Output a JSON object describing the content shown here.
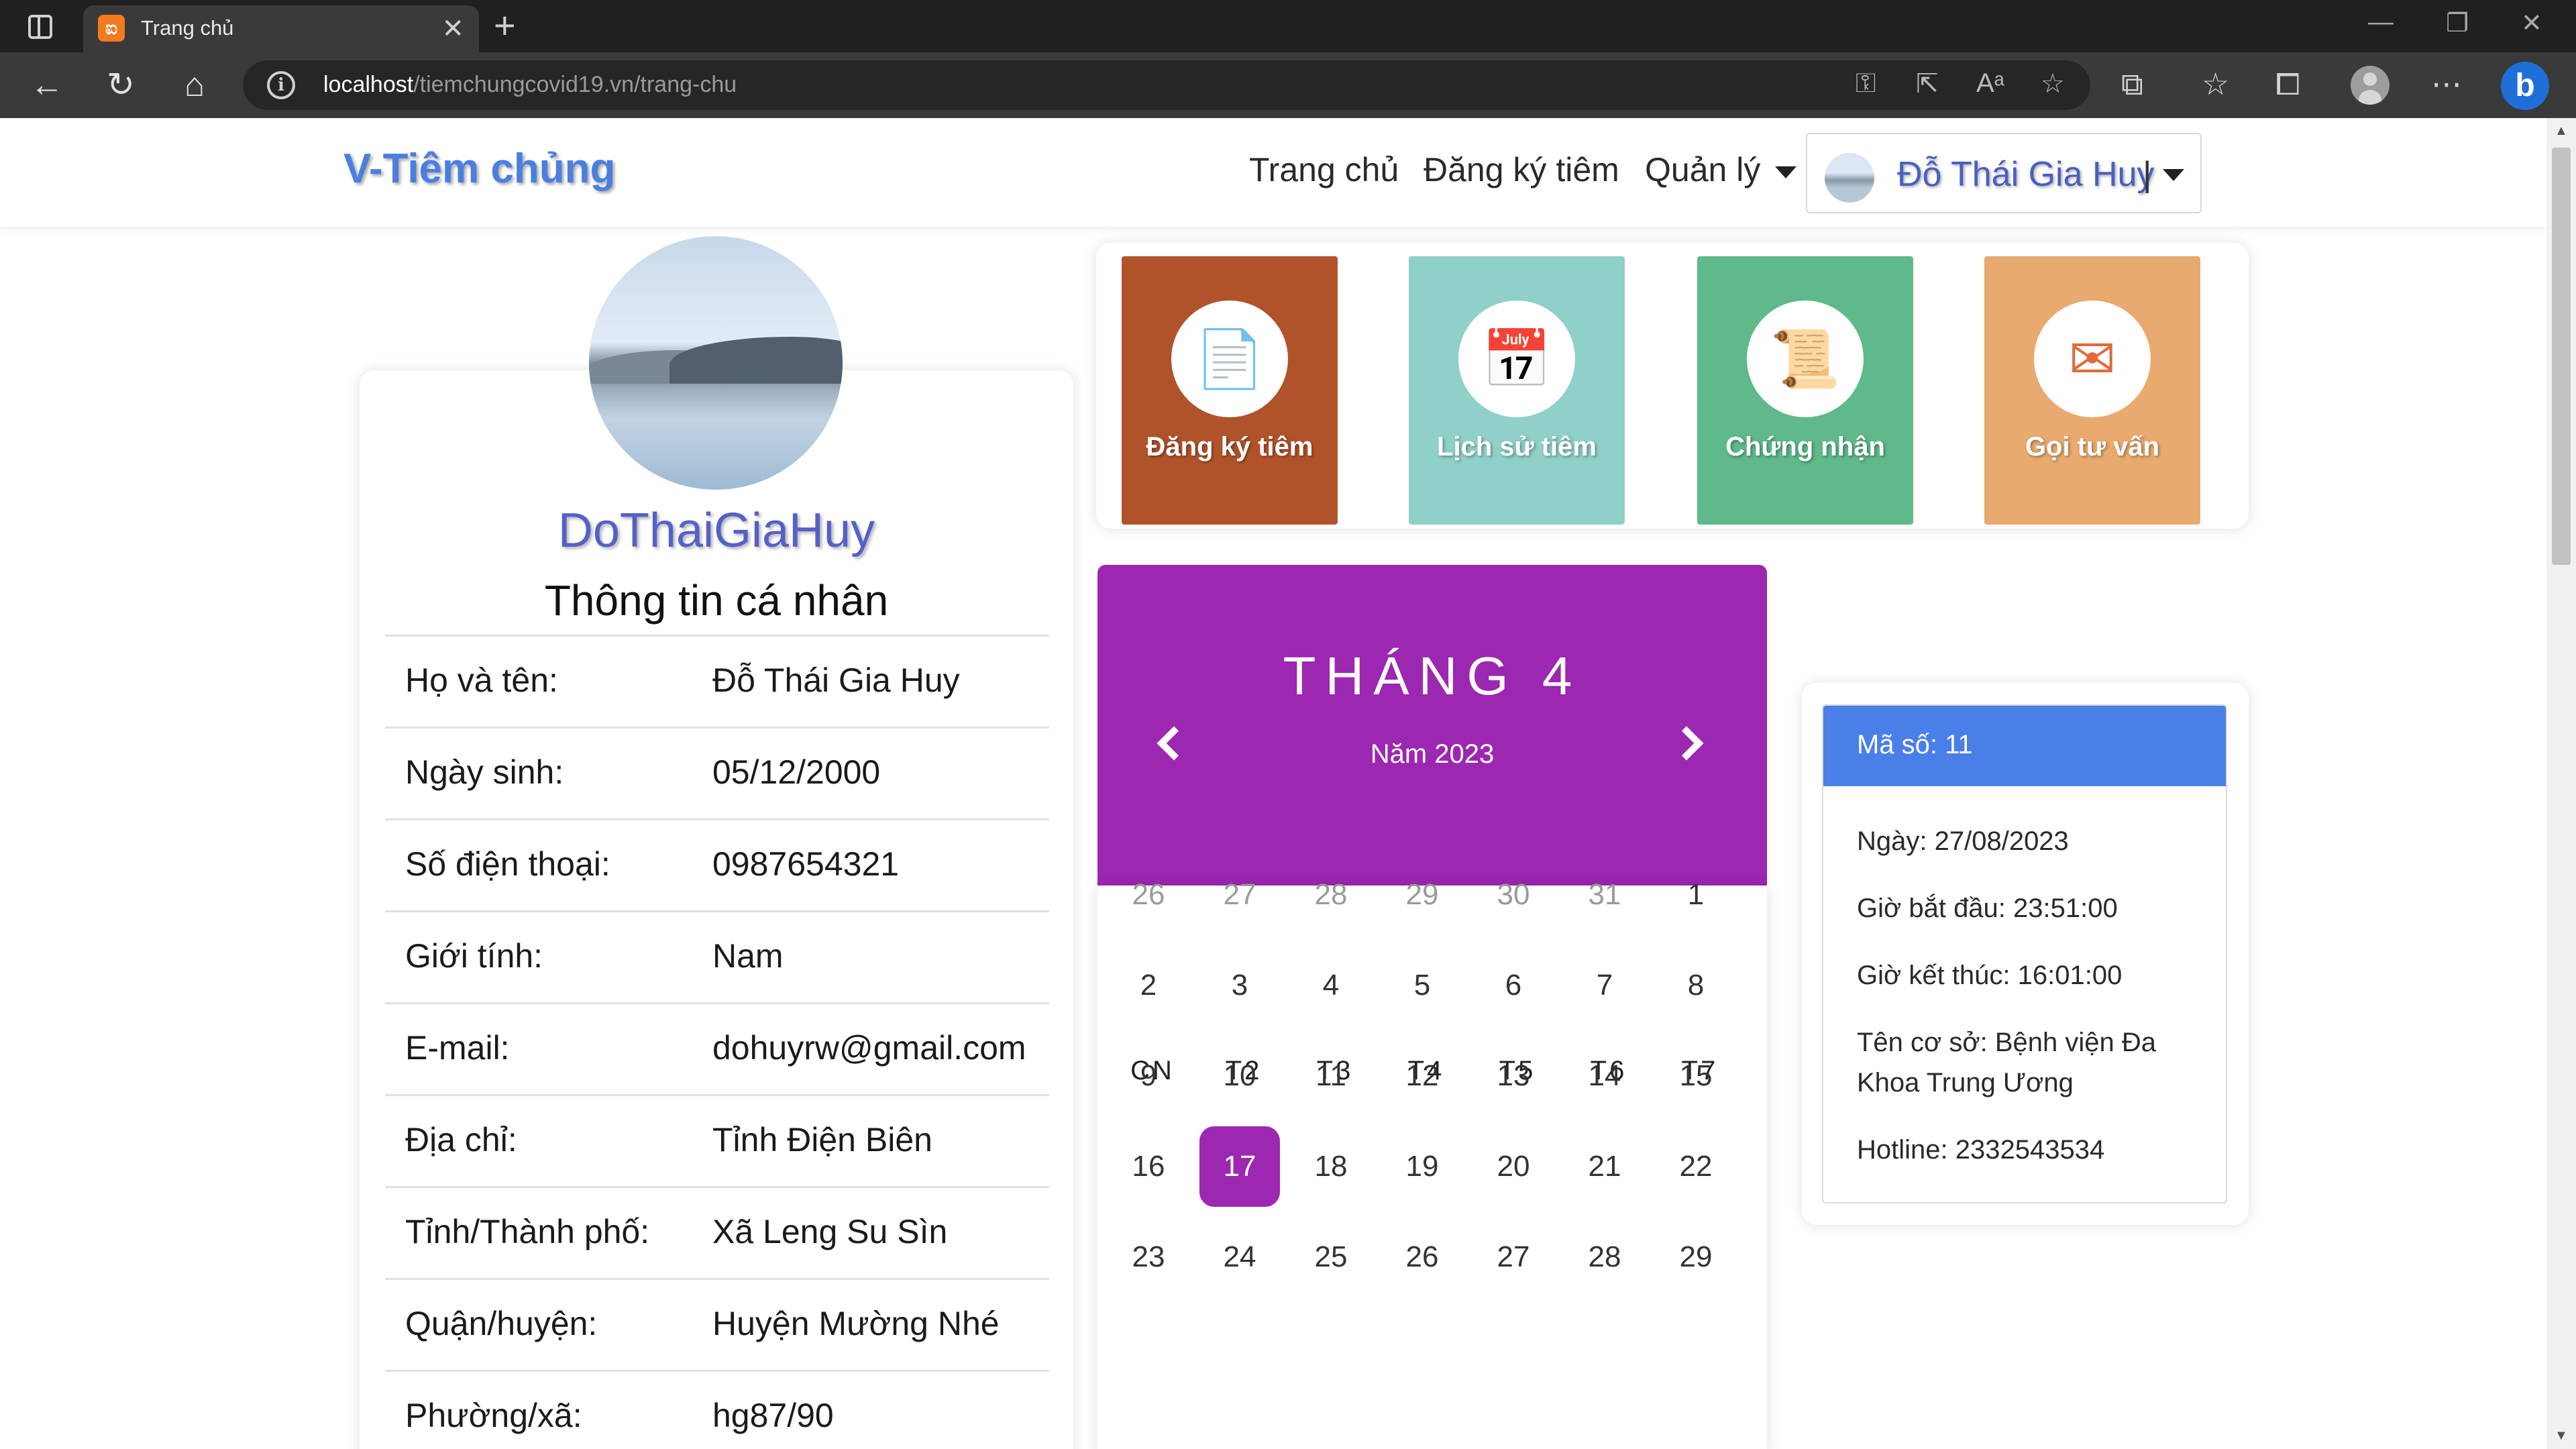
{
  "browser": {
    "tab_title": "Trang chủ",
    "address_host": "localhost",
    "address_path": "/tiemchungcovid19.vn/trang-chu"
  },
  "site": {
    "brand": "V-Tiêm chủng",
    "menu": [
      "Trang chủ",
      "Đăng ký tiêm",
      "Quản lý"
    ],
    "user_display_name": "Đỗ Thái Gia Huy",
    "user_separator": "|"
  },
  "profile": {
    "username": "DoThaiGiaHuy",
    "heading": "Thông tin cá nhân",
    "fields": [
      {
        "label": "Họ và tên:",
        "value": "Đỗ Thái Gia Huy"
      },
      {
        "label": "Ngày sinh:",
        "value": "05/12/2000"
      },
      {
        "label": "Số điện thoại:",
        "value": "0987654321"
      },
      {
        "label": "Giới tính:",
        "value": "Nam"
      },
      {
        "label": "E-mail:",
        "value": "dohuyrw@gmail.com"
      },
      {
        "label": "Địa chỉ:",
        "value": "Tỉnh Điện Biên"
      },
      {
        "label": "Tỉnh/Thành phố:",
        "value": "Xã Leng Su Sìn"
      },
      {
        "label": "Quận/huyện:",
        "value": "Huyện Mường Nhé"
      },
      {
        "label": "Phường/xã:",
        "value": "hg87/90"
      }
    ]
  },
  "actions": [
    {
      "label": "Đăng ký tiêm",
      "icon": "document-icon",
      "color": "#b0532a"
    },
    {
      "label": "Lịch sử tiêm",
      "icon": "calendar-icon",
      "color": "#8fd0c8"
    },
    {
      "label": "Chứng nhận",
      "icon": "certificate-icon",
      "color": "#5fb98a"
    },
    {
      "label": "Gọi tư vấn",
      "icon": "mail-icon",
      "color": "#e8aa6e"
    }
  ],
  "calendar": {
    "month_label": "THÁNG 4",
    "year_label": "Năm 2023",
    "weekdays": [
      "CN",
      "T2",
      "T3",
      "T4",
      "T5",
      "T6",
      "T7"
    ],
    "weeks": [
      [
        "26",
        "27",
        "28",
        "29",
        "30",
        "31",
        "1"
      ],
      [
        "2",
        "3",
        "4",
        "5",
        "6",
        "7",
        "8"
      ],
      [
        "9",
        "10",
        "11",
        "12",
        "13",
        "14",
        "15"
      ],
      [
        "16",
        "17",
        "18",
        "19",
        "20",
        "21",
        "22"
      ],
      [
        "23",
        "24",
        "25",
        "26",
        "27",
        "28",
        "29"
      ]
    ],
    "selected_day": "17",
    "accent": "#9c27b0"
  },
  "appointment": {
    "code": "Mã số: 11",
    "date": "Ngày: 27/08/2023",
    "start": "Giờ bắt đầu: 23:51:00",
    "end": "Giờ kết thúc: 16:01:00",
    "facility": "Tên cơ sở: Bệnh viện Đa Khoa Trung Ương",
    "hotline": "Hotline: 2332543534"
  }
}
